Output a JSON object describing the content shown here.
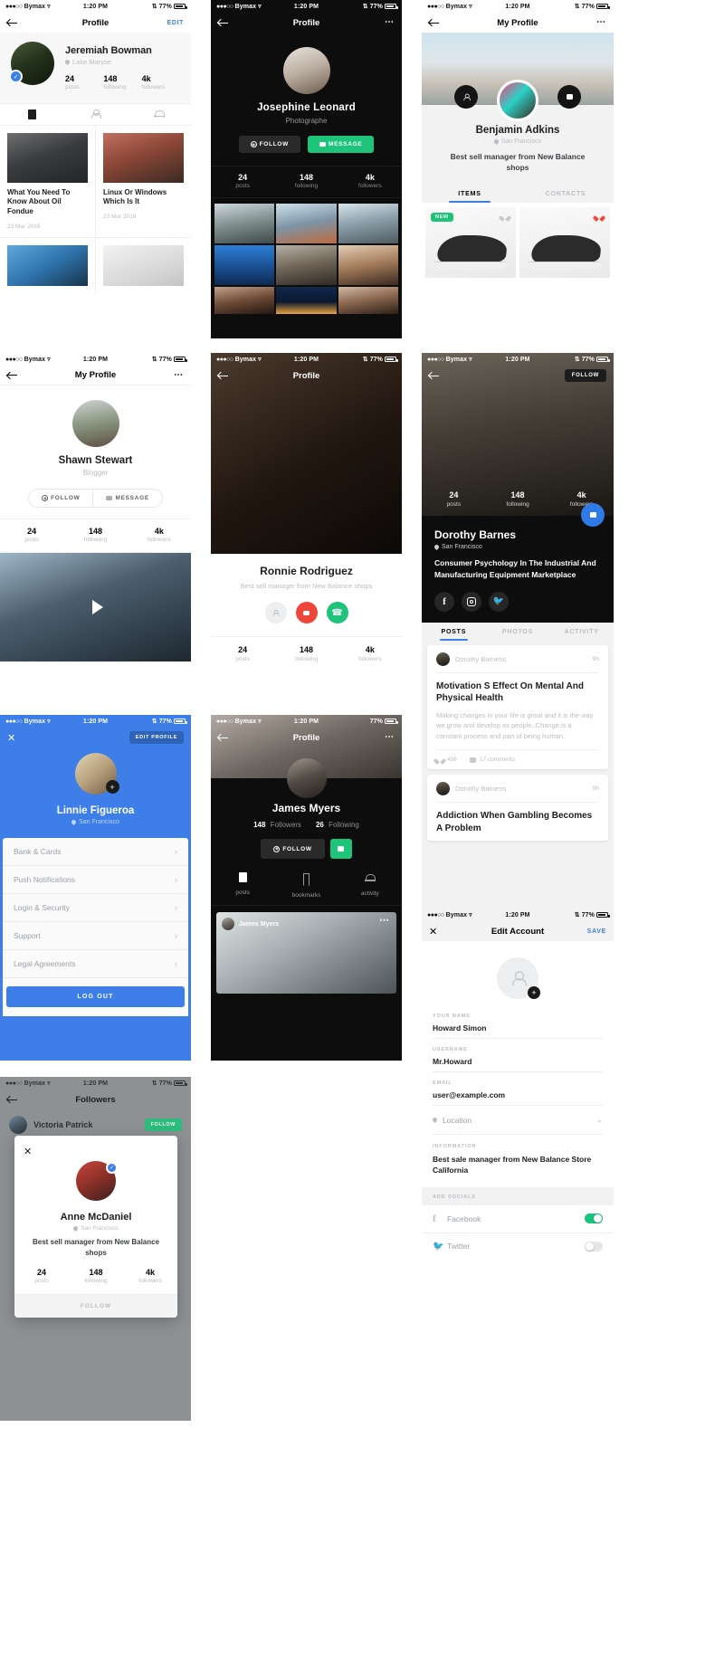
{
  "status_bar": {
    "carrier": "Bymax",
    "time": "1:20 PM",
    "battery": "77%"
  },
  "screens": {
    "jeremiah": {
      "nav_title": "Profile",
      "edit_label": "EDIT",
      "name": "Jeremiah Bowman",
      "location": "Lake Maryse",
      "stats": [
        {
          "num": "24",
          "label": "posts"
        },
        {
          "num": "148",
          "label": "following"
        },
        {
          "num": "4k",
          "label": "followers"
        }
      ],
      "tabs": [
        "posts-icon",
        "person-icon",
        "bell-icon"
      ],
      "articles": [
        {
          "title": "What You Need To Know About Oil Fondue",
          "date": "23 Mar 2016"
        },
        {
          "title": "Linux Or Windows Which Is It",
          "date": "23 Mar 2016"
        }
      ]
    },
    "josephine": {
      "nav_title": "Profile",
      "name": "Josephine Leonard",
      "role": "Photographe",
      "follow_label": "FOLLOW",
      "message_label": "MESSAGE",
      "stats": [
        {
          "num": "24",
          "label": "posts"
        },
        {
          "num": "148",
          "label": "following"
        },
        {
          "num": "4k",
          "label": "followers"
        }
      ]
    },
    "benjamin": {
      "nav_title": "My Profile",
      "name": "Benjamin Adkins",
      "location": "San Francisco",
      "bio": "Best sell manager from New Balance shops",
      "tabs": [
        {
          "label": "ITEMS",
          "active": true
        },
        {
          "label": "CONTACTS",
          "active": false
        }
      ],
      "badge_new": "NEW"
    },
    "shawn": {
      "nav_title": "My Profile",
      "name": "Shawn Stewart",
      "role": "Blogger",
      "follow_label": "FOLLOW",
      "message_label": "MESSAGE",
      "stats": [
        {
          "num": "24",
          "label": "posts"
        },
        {
          "num": "148",
          "label": "following"
        },
        {
          "num": "4k",
          "label": "followers"
        }
      ]
    },
    "ronnie": {
      "nav_title": "Profile",
      "name": "Ronnie Rodriguez",
      "bio": "Best sell manager from New Balance shops",
      "stats": [
        {
          "num": "24",
          "label": "posts"
        },
        {
          "num": "148",
          "label": "following"
        },
        {
          "num": "4k",
          "label": "followers"
        }
      ]
    },
    "dorothy": {
      "follow_label": "FOLLOW",
      "name": "Dorothy Barnes",
      "location": "San Francisco",
      "bio": "Consumer Psychology In The Industrial And Manufacturing Equipment Marketplace",
      "stats": [
        {
          "num": "24",
          "label": "posts"
        },
        {
          "num": "148",
          "label": "following"
        },
        {
          "num": "4k",
          "label": "followers"
        }
      ],
      "socials": [
        "facebook-icon",
        "instagram-icon",
        "twitter-icon"
      ],
      "tabs": [
        {
          "label": "POSTS",
          "active": true
        },
        {
          "label": "PHOTOS",
          "active": false
        },
        {
          "label": "ACTIVITY",
          "active": false
        }
      ],
      "posts": [
        {
          "author": "Dorothy Barnens",
          "time": "9h",
          "title": "Motivation S Effect On Mental And Physical Health",
          "body": "Making changes in your life is great and it is the way we grow and develop as people. Change is a constant process and part of being human.",
          "likes": "456",
          "comments": "17 comments"
        },
        {
          "author": "Dorothy Barnens",
          "time": "9h",
          "title": "Addiction When Gambling Becomes A Problem"
        }
      ]
    },
    "linnie": {
      "edit_profile_label": "EDIT PROFILE",
      "name": "Linnie Figueroa",
      "location": "San Francisco",
      "menu": [
        "Bank & Cards",
        "Push Notifications",
        "Login & Security",
        "Support",
        "Legal Agreements"
      ],
      "logout_label": "LOG OUT"
    },
    "james": {
      "nav_title": "Profile",
      "name": "James Myers",
      "followers_num": "148",
      "followers_label": "Followers",
      "following_num": "26",
      "following_label": "Following",
      "follow_label": "FOLLOW",
      "tabs": [
        {
          "label": "posts",
          "icon": "doc-icon"
        },
        {
          "label": "bookmarks",
          "icon": "bookmark-icon"
        },
        {
          "label": "activity",
          "icon": "bell-icon"
        }
      ],
      "feed_caption": "James Myers"
    },
    "edit_account": {
      "nav_title": "Edit Account",
      "save_label": "SAVE",
      "fields": [
        {
          "label": "YOUR NAME",
          "value": "Howard Simon"
        },
        {
          "label": "USERNAME",
          "value": "Mr.Howard"
        },
        {
          "label": "EMAIL",
          "value": "user@example.com"
        }
      ],
      "location_label": "Location",
      "information_label": "INFORMATION",
      "information_value": "Best sale manager from New Balance Store California",
      "add_socials_label": "ADD SOCIALS",
      "socials": [
        {
          "name": "Facebook",
          "on": true
        },
        {
          "name": "Twitter",
          "on": false
        }
      ]
    },
    "followers": {
      "nav_title": "Followers",
      "list": [
        {
          "name": "Victoria Patrick",
          "action": "FOLLOW"
        }
      ],
      "modal": {
        "name": "Anne McDaniel",
        "location": "San Francisco",
        "bio": "Best sell manager from New Balance shops",
        "stats": [
          {
            "num": "24",
            "label": "posts"
          },
          {
            "num": "148",
            "label": "following"
          },
          {
            "num": "4k",
            "label": "followers"
          }
        ],
        "follow_label": "FOLLOW"
      }
    }
  },
  "colors": {
    "blue": "#3d7ee8",
    "green": "#1ec47a",
    "red": "#f04a36",
    "dark": "#0d0d0d"
  }
}
